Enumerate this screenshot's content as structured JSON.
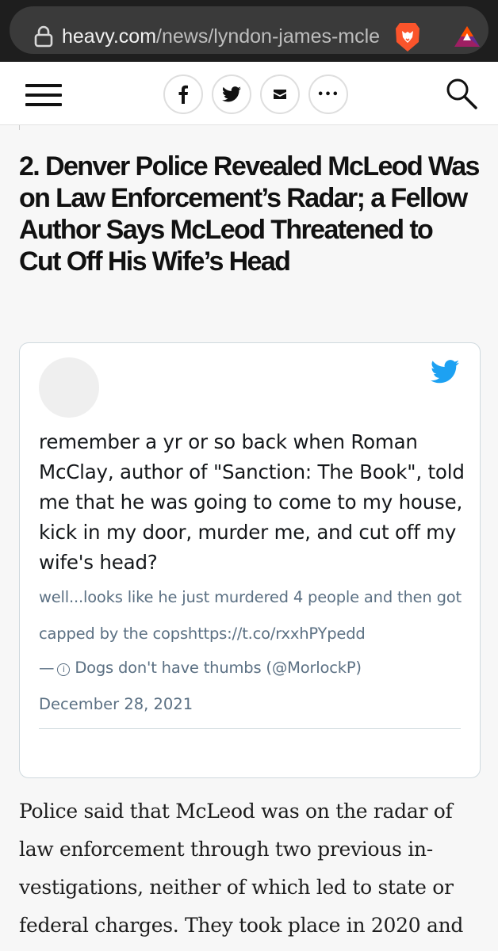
{
  "browser": {
    "url_host": "heavy.com",
    "url_path": "/news/lyndon-james-mcle",
    "icons": [
      "lock-icon",
      "brave-lion-icon",
      "brave-rewards-icon"
    ]
  },
  "site_header": {
    "icons": [
      "menu-icon",
      "facebook-icon",
      "twitter-icon",
      "email-icon",
      "more-icon",
      "search-icon"
    ],
    "more_glyph": "•••"
  },
  "article": {
    "headline": "2. Denver Police Revealed McLeod Was on Law Enforcement’s Radar; a Fellow Author Says McLeod Threatened to Cut Off His Wife’s Head",
    "body": "Police said that McLeod was on the radar of law enforcement through two previous in-vestigations, neither of which led to state or federal charges. They took place in 2020 and"
  },
  "tweet": {
    "text": "remember a yr or so back when Roman McClay, author of \"Sanction: The Book\", told me that he was going to come to my house, kick in my door, murder me, and cut off my wife's head?",
    "continuation": "well...looks like he just murdered 4 people and then got capped by the copshttps://t.co/rxxhPYpedd",
    "author_prefix": "—",
    "author": "Dogs don't have thumbs (@MorlockP)",
    "date": "December 28, 2021",
    "colors": {
      "bird": "#1da1f2",
      "border": "#cfd9de",
      "muted": "#5b7083"
    }
  }
}
